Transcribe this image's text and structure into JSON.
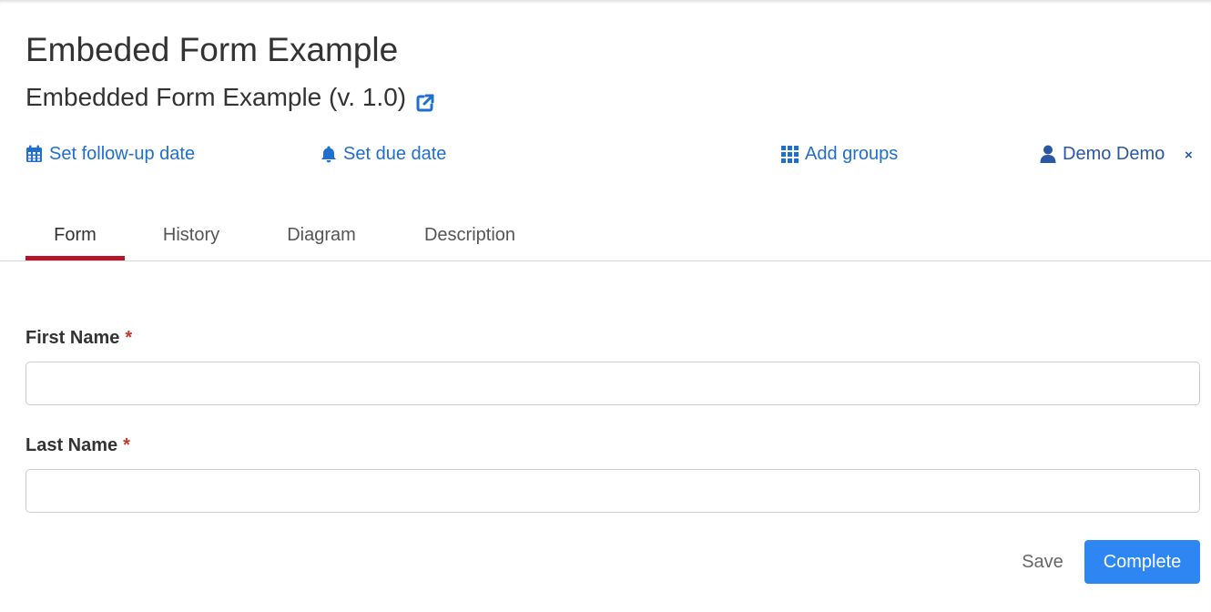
{
  "header": {
    "task_name": "Embeded Form Example",
    "process_name": "Embedded Form Example (v. 1.0)"
  },
  "actions": {
    "follow_up": "Set follow-up date",
    "due_date": "Set due date",
    "groups": "Add groups",
    "assignee": "Demo Demo",
    "remove_assignee": "×"
  },
  "tabs": [
    {
      "label": "Form",
      "active": true
    },
    {
      "label": "History",
      "active": false
    },
    {
      "label": "Diagram",
      "active": false
    },
    {
      "label": "Description",
      "active": false
    }
  ],
  "form": {
    "first_name_label": "First Name",
    "last_name_label": "Last Name",
    "required_marker": "*",
    "first_name_value": "",
    "last_name_value": ""
  },
  "buttons": {
    "save": "Save",
    "complete": "Complete"
  },
  "colors": {
    "link": "#1f6fcf",
    "active_tab": "#b5152b",
    "primary_button": "#2e86f3",
    "required": "#c0392b"
  },
  "icons": {
    "external_link": "external-link-icon",
    "follow_up": "calendar-icon",
    "due_date": "bell-icon",
    "groups": "grid-icon",
    "assignee": "user-icon"
  }
}
